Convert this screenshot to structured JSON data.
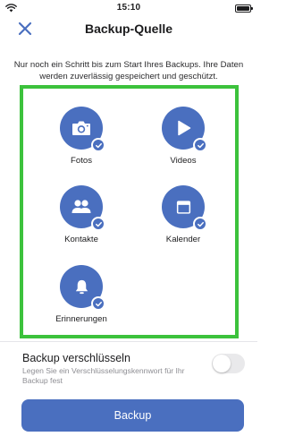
{
  "status_bar": {
    "time": "15:10"
  },
  "nav": {
    "title": "Backup-Quelle",
    "close_icon": "close-icon"
  },
  "intro_text": "Nur noch ein Schritt bis zum Start Ihres Backups. Ihre Daten werden zuverlässig gespeichert und geschützt.",
  "sources": [
    {
      "label": "Fotos",
      "icon": "camera-icon",
      "checked": true
    },
    {
      "label": "Videos",
      "icon": "play-icon",
      "checked": true
    },
    {
      "label": "Kontakte",
      "icon": "contacts-icon",
      "checked": true
    },
    {
      "label": "Kalender",
      "icon": "calendar-icon",
      "checked": true
    },
    {
      "label": "Erinnerungen",
      "icon": "bell-icon",
      "checked": true
    }
  ],
  "encryption": {
    "title": "Backup verschlüsseln",
    "subtitle": "Legen Sie ein Verschlüsselungskennwort für Ihr Backup fest",
    "enabled": false
  },
  "backup_button": {
    "label": "Backup"
  },
  "colors": {
    "accent": "#4a6fbf",
    "highlight_border": "#3cc23c",
    "muted_text": "#8e8e93"
  }
}
